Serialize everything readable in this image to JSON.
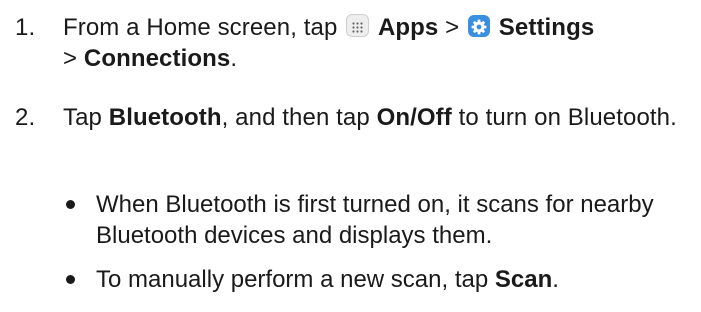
{
  "steps": [
    {
      "number": "1.",
      "t1": "From a Home screen, tap ",
      "apps_icon": "apps-grid-icon",
      "b1": "Apps",
      "t2": " > ",
      "settings_icon": "gear-icon",
      "b2": "Settings",
      "t3": " > ",
      "b3": "Connections",
      "t4": "."
    },
    {
      "number": "2.",
      "t1": "Tap ",
      "b1": "Bluetooth",
      "t2": ", and then tap ",
      "b2": "On/Off",
      "t3": " to turn on Bluetooth."
    }
  ],
  "bullets": [
    {
      "text": "When Bluetooth is first turned on, it scans for nearby Bluetooth devices and displays them."
    },
    {
      "t1": "To manually perform a new scan, tap ",
      "b1": "Scan",
      "t2": "."
    }
  ],
  "colors": {
    "text": "#1a1a1a",
    "settings_icon_bg": "#3a8fe0",
    "apps_icon_bg": "#eeeeee"
  }
}
